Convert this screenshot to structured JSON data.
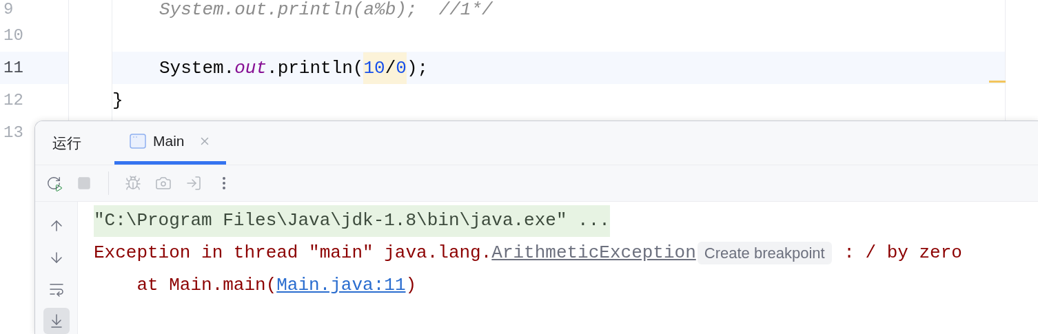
{
  "editor": {
    "lines": [
      {
        "number": "9",
        "current": false,
        "kind": "statement",
        "tokens": [
          {
            "text": "System.out.println(a%b);  //1*/",
            "kind": "comment",
            "highlighted": false
          }
        ]
      },
      {
        "number": "10",
        "current": false,
        "kind": "blank"
      },
      {
        "number": "11",
        "current": true,
        "kind": "statement",
        "tokens": [
          {
            "text": "System.",
            "kind": "plain",
            "highlighted": false
          },
          {
            "text": "out",
            "kind": "field",
            "highlighted": false
          },
          {
            "text": ".println(",
            "kind": "plain",
            "highlighted": false
          },
          {
            "text": "10",
            "kind": "number",
            "highlighted": true
          },
          {
            "text": "/",
            "kind": "plain",
            "highlighted": true
          },
          {
            "text": "0",
            "kind": "number",
            "highlighted": true
          },
          {
            "text": ");",
            "kind": "plain",
            "highlighted": false
          }
        ]
      },
      {
        "number": "12",
        "current": false,
        "kind": "closing-brace",
        "tokens": [
          {
            "text": "}",
            "kind": "plain",
            "highlighted": false
          }
        ]
      },
      {
        "number": "13",
        "current": false,
        "kind": "blank"
      }
    ]
  },
  "run_panel": {
    "title": "运行",
    "tabs": [
      {
        "label": "Main",
        "selected": true
      }
    ],
    "toolbar": [
      {
        "kind": "rerun",
        "disabled": false
      },
      {
        "kind": "stop",
        "disabled": true
      },
      {
        "kind": "separator"
      },
      {
        "kind": "debug",
        "disabled": true
      },
      {
        "kind": "camera",
        "disabled": true
      },
      {
        "kind": "exit",
        "disabled": true
      },
      {
        "kind": "more",
        "disabled": false
      }
    ],
    "gutter": [
      {
        "kind": "up",
        "on": false
      },
      {
        "kind": "down",
        "on": false
      },
      {
        "kind": "wrap",
        "on": false
      },
      {
        "kind": "scroll-end",
        "on": true
      }
    ],
    "console": [
      {
        "kind": "command",
        "parts": [
          {
            "kind": "text",
            "text": "\"C:\\Program Files\\Java\\jdk-1.8\\bin\\java.exe\" ..."
          }
        ]
      },
      {
        "kind": "error",
        "parts": [
          {
            "kind": "text",
            "text": "Exception in thread \"main\" java.lang."
          },
          {
            "kind": "class-link",
            "text": "ArithmeticException"
          },
          {
            "kind": "hint",
            "text": "Create breakpoint"
          },
          {
            "kind": "text",
            "text": " : / by zero"
          }
        ]
      },
      {
        "kind": "error",
        "parts": [
          {
            "kind": "text",
            "text": "    at Main.main("
          },
          {
            "kind": "file-link",
            "text": "Main.java:11"
          },
          {
            "kind": "text",
            "text": ")"
          }
        ]
      }
    ]
  }
}
